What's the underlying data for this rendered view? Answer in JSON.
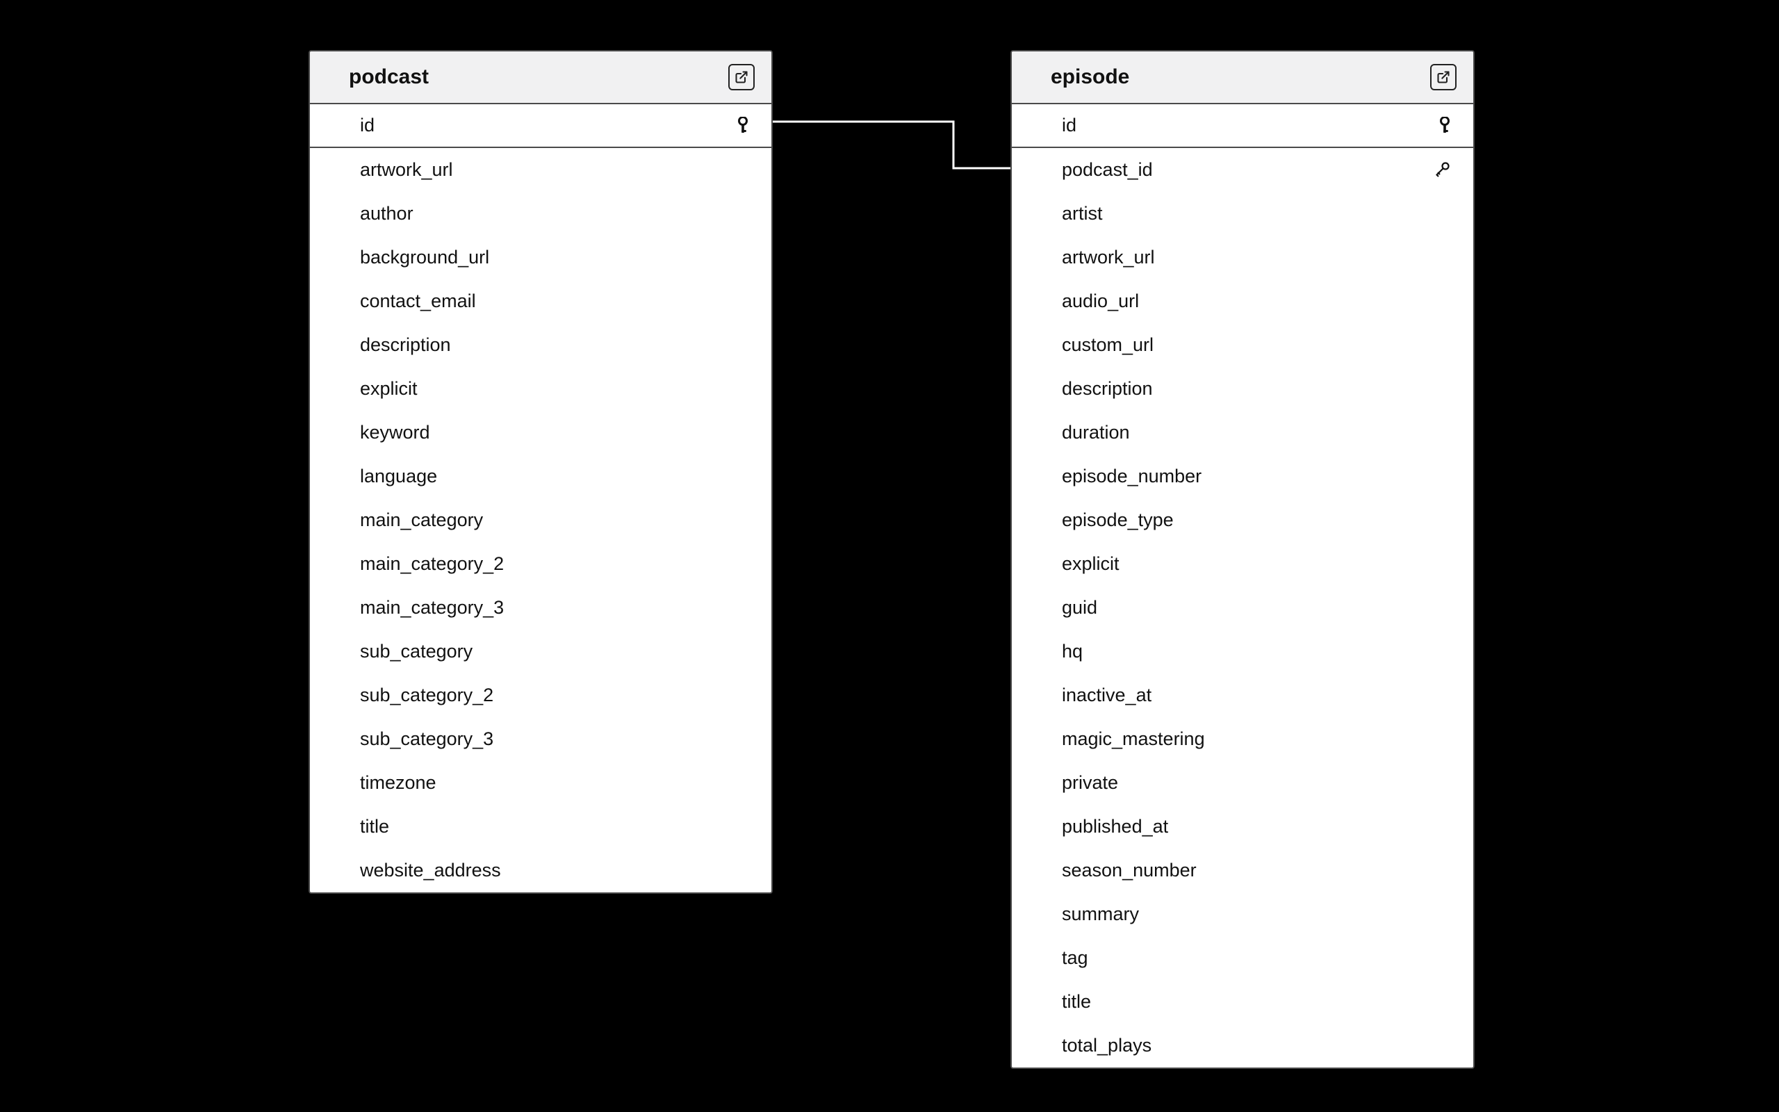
{
  "tables": {
    "podcast": {
      "title": "podcast",
      "columns": [
        {
          "name": "id",
          "pk": true
        },
        {
          "name": "artwork_url"
        },
        {
          "name": "author"
        },
        {
          "name": "background_url"
        },
        {
          "name": "contact_email"
        },
        {
          "name": "description"
        },
        {
          "name": "explicit"
        },
        {
          "name": "keyword"
        },
        {
          "name": "language"
        },
        {
          "name": "main_category"
        },
        {
          "name": "main_category_2"
        },
        {
          "name": "main_category_3"
        },
        {
          "name": "sub_category"
        },
        {
          "name": "sub_category_2"
        },
        {
          "name": "sub_category_3"
        },
        {
          "name": "timezone"
        },
        {
          "name": "title"
        },
        {
          "name": "website_address"
        }
      ]
    },
    "episode": {
      "title": "episode",
      "columns": [
        {
          "name": "id",
          "pk": true
        },
        {
          "name": "podcast_id",
          "fk": true
        },
        {
          "name": "artist"
        },
        {
          "name": "artwork_url"
        },
        {
          "name": "audio_url"
        },
        {
          "name": "custom_url"
        },
        {
          "name": "description"
        },
        {
          "name": "duration"
        },
        {
          "name": "episode_number"
        },
        {
          "name": "episode_type"
        },
        {
          "name": "explicit"
        },
        {
          "name": "guid"
        },
        {
          "name": "hq"
        },
        {
          "name": "inactive_at"
        },
        {
          "name": "magic_mastering"
        },
        {
          "name": "private"
        },
        {
          "name": "published_at"
        },
        {
          "name": "season_number"
        },
        {
          "name": "summary"
        },
        {
          "name": "tag"
        },
        {
          "name": "title"
        },
        {
          "name": "total_plays"
        }
      ]
    }
  },
  "relationship": {
    "from_table": "podcast",
    "from_column": "id",
    "to_table": "episode",
    "to_column": "podcast_id"
  }
}
